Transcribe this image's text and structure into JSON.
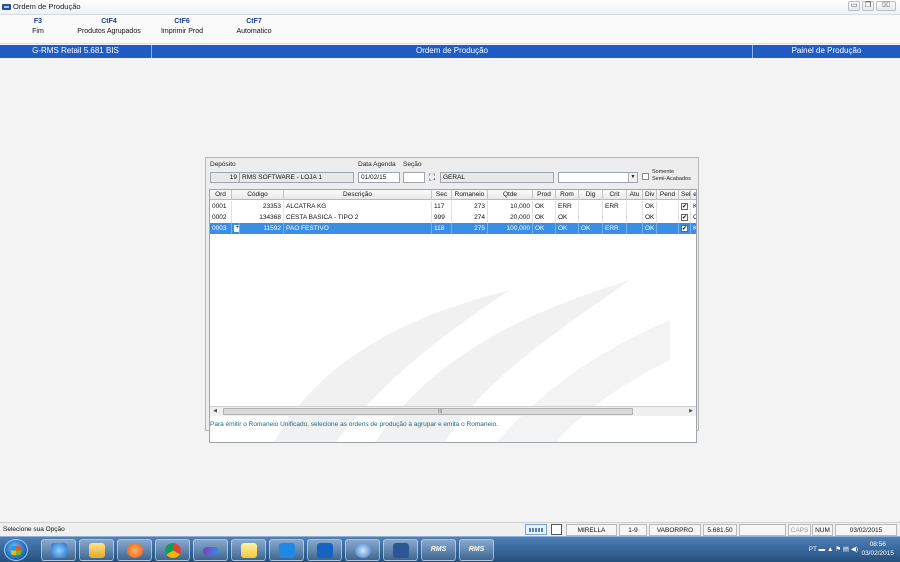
{
  "window": {
    "title": "Ordem de Produção",
    "buttons": {
      "minimize": "▭",
      "maximize": "❐",
      "close": "⌧"
    }
  },
  "fkeys": [
    {
      "key": "F3",
      "label": "Fim"
    },
    {
      "key": "CtF4",
      "label": "Produtos Agrupados"
    },
    {
      "key": "CtF6",
      "label": "Imprimir Prod"
    },
    {
      "key": "CtF7",
      "label": "Automatico"
    }
  ],
  "header": {
    "left": "G-RMS Retail 5.681 BIS",
    "center": "Ordem de Produção",
    "right": "Painel de Produção"
  },
  "form": {
    "deposito_label": "Depósito",
    "deposito_code": "19",
    "deposito_name": "RMS SOFTWARE - LOJA 1",
    "data_agenda_label": "Data Agenda",
    "data_agenda_value": "01/02/15",
    "secao_label": "Seção",
    "secao_value": "",
    "geral_value": "GERAL",
    "somente_label_1": "Somente",
    "somente_label_2": "Semi-Acabados"
  },
  "grid": {
    "columns": [
      "Ord",
      "Código",
      "Descrição",
      "Sec",
      "Romaneio",
      "Qtde",
      "Prod",
      "Rom",
      "Dig",
      "Crit",
      "Atu",
      "Div",
      "Pend",
      "Sel",
      "e"
    ],
    "rows": [
      {
        "ord": "0001",
        "codigo": "23353",
        "descricao": "ALCATRA KG",
        "sec": "117",
        "romaneio": "273",
        "qtde": "10,000",
        "prod": "OK",
        "rom": "ERR",
        "dig": "",
        "crit": "ERR",
        "atu": "",
        "div": "OK",
        "pend": "",
        "sel": "✔",
        "e": "K"
      },
      {
        "ord": "0002",
        "codigo": "134368",
        "descricao": "CESTA BASICA - TIPO 2",
        "sec": "999",
        "romaneio": "274",
        "qtde": "20,000",
        "prod": "OK",
        "rom": "OK",
        "dig": "",
        "crit": "",
        "atu": "",
        "div": "OK",
        "pend": "",
        "sel": "✔",
        "e": "C"
      },
      {
        "ord": "0003",
        "codigo": "11592",
        "descricao": "PAO FESTIVO",
        "sec": "118",
        "romaneio": "275",
        "qtde": "100,000",
        "prod": "OK",
        "rom": "OK",
        "dig": "OK",
        "crit": "ERR",
        "atu": "",
        "div": "OK",
        "pend": "",
        "sel": "✔",
        "e": "K",
        "expand": "+"
      }
    ],
    "scroll_grip": "III"
  },
  "hint": "Para emitir o Romaneio Unificado, selecione as ordens de produção à agrupar e emita o Romaneio.",
  "statusbar": {
    "message": "Selecione sua Opção",
    "user": "MIRELLA",
    "range": "1-9",
    "profile": "VABORPRO",
    "version": "5.681.50",
    "caps": "CAPS",
    "num": "NUM",
    "date": "03/02/2015"
  },
  "taskbar": {
    "apps": [
      "ie",
      "explorer",
      "media",
      "chrome",
      "link",
      "folder",
      "lync",
      "outlook",
      "remote",
      "word",
      "rms",
      "rms"
    ],
    "rms_label": "RMS",
    "lang": "PT",
    "clock_time": "08:56",
    "clock_date": "03/02/2015"
  },
  "colors": {
    "header_blue": "#1f5cc6",
    "selected_row": "#3a8ee6",
    "hint_text": "#1c6a8a"
  }
}
